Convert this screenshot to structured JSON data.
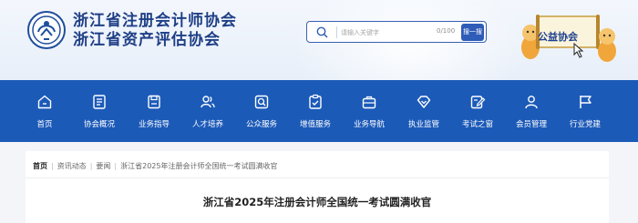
{
  "header": {
    "org_name_1": "浙江省注册会计师协会",
    "org_name_2": "浙江省资产评估协会",
    "logo_icon": "association-emblem-icon"
  },
  "search": {
    "placeholder": "请输入关键字",
    "count": "0/100",
    "button_label": "搜一搜",
    "icon": "search-icon"
  },
  "public_welfare": {
    "label": "公益协会",
    "icon": "cartoon-mascots-icon"
  },
  "nav": {
    "items": [
      {
        "label": "首页",
        "icon": "home-icon"
      },
      {
        "label": "协会概况",
        "icon": "document-icon"
      },
      {
        "label": "业务指导",
        "icon": "save-icon"
      },
      {
        "label": "人才培养",
        "icon": "people-icon"
      },
      {
        "label": "公众服务",
        "icon": "search-doc-icon"
      },
      {
        "label": "增值服务",
        "icon": "checklist-icon"
      },
      {
        "label": "业务导航",
        "icon": "briefcase-icon"
      },
      {
        "label": "执业监管",
        "icon": "diamond-icon"
      },
      {
        "label": "考试之窗",
        "icon": "edit-icon"
      },
      {
        "label": "会员管理",
        "icon": "member-icon"
      },
      {
        "label": "行业党建",
        "icon": "flag-icon"
      }
    ]
  },
  "breadcrumb": {
    "home": "首页",
    "level1": "资讯动态",
    "level2": "要闻",
    "current": "浙江省2025年注册会计师全国统一考试圆满收官"
  },
  "article": {
    "title": "浙江省2025年注册会计师全国统一考试圆满收官"
  },
  "colors": {
    "nav_bg": "#1c5ab8",
    "brand_text": "#1f3f86",
    "search_button": "#2e5cb8"
  }
}
